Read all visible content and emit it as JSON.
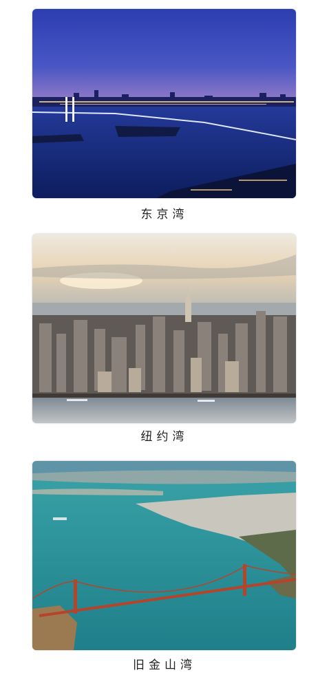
{
  "gallery": {
    "items": [
      {
        "caption": "东京湾",
        "image": "tokyo-bay-night-photo"
      },
      {
        "caption": "纽约湾",
        "image": "new-york-bay-aerial-photo"
      },
      {
        "caption": "旧金山湾",
        "image": "san-francisco-bay-aerial-photo"
      }
    ]
  }
}
